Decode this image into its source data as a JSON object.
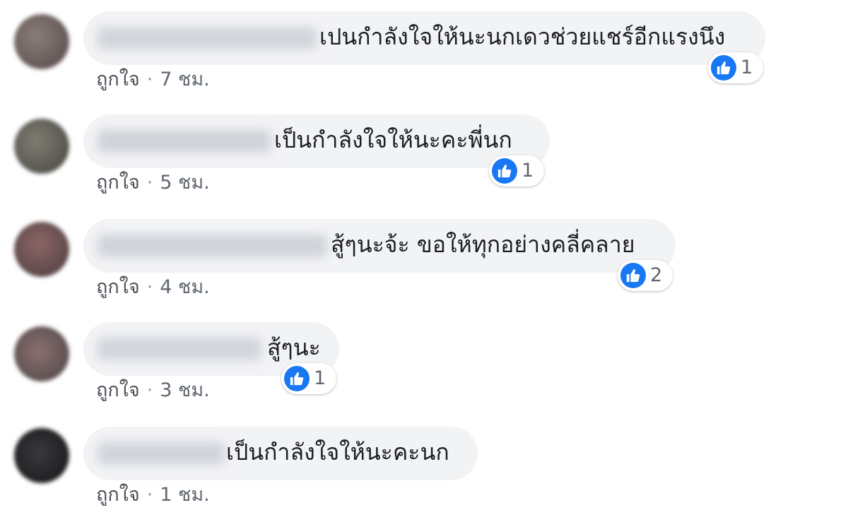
{
  "colors": {
    "bubble": "#f2f3f5",
    "like_blue": "#1877f2",
    "meta_text": "#606770"
  },
  "comments": [
    {
      "text": "เปนกำลังใจให้นะนกเดวช่วยแชร์อีกแรงนึง",
      "reactions": {
        "icon": "like-icon",
        "count": "1"
      },
      "like_label": "ถูกใจ",
      "separator": "·",
      "time": "7 ชม."
    },
    {
      "text": "เป็นกำลังใจให้นะคะพี่นก",
      "reactions": {
        "icon": "like-icon",
        "count": "1"
      },
      "like_label": "ถูกใจ",
      "separator": "·",
      "time": "5 ชม."
    },
    {
      "text": "สู้ๆนะจ้ะ ขอให้ทุกอย่างคลี่คลาย",
      "reactions": {
        "icon": "like-icon",
        "count": "2"
      },
      "like_label": "ถูกใจ",
      "separator": "·",
      "time": "4 ชม."
    },
    {
      "text": "สู้ๆนะ",
      "reactions": {
        "icon": "like-icon",
        "count": "1"
      },
      "like_label": "ถูกใจ",
      "separator": "·",
      "time": "3 ชม."
    },
    {
      "text": "เป็นกำลังใจให้นะคะนก",
      "reactions": {
        "icon": "like-icon",
        "count": ""
      },
      "like_label": "ถูกใจ",
      "separator": "·",
      "time": "1 ชม."
    }
  ]
}
